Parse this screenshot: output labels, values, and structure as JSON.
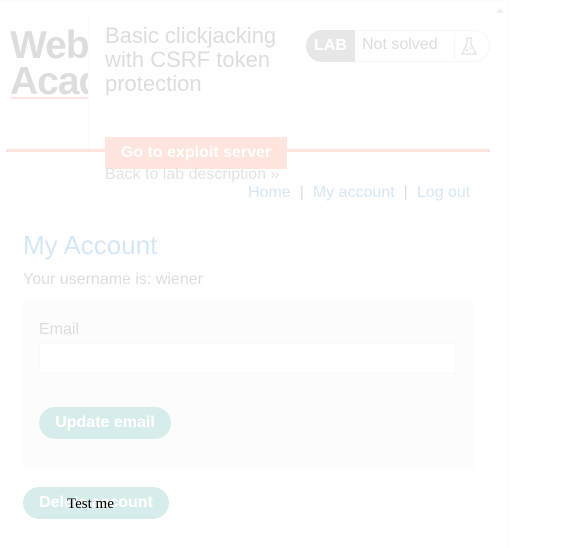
{
  "logo": {
    "text": "Web Security Academy"
  },
  "lab": {
    "title": "Basic clickjacking with CSRF token protection",
    "status_badge": "LAB",
    "status_text": "Not solved",
    "exploit_button": "Go to exploit server",
    "back_link": "Back to lab description",
    "back_link_icon": "double-chevron-right-icon",
    "flask_icon": "flask-icon"
  },
  "nav": {
    "home": "Home",
    "separator": "|",
    "my_account": "My account",
    "log_out": "Log out"
  },
  "account": {
    "heading": "My Account",
    "username_line": "Your username is: wiener",
    "email_label": "Email",
    "email_value": "",
    "update_button": "Update email",
    "delete_button": "Delete account"
  },
  "decoy": {
    "text": "Test me"
  },
  "colors": {
    "accent_orange": "#ff6633",
    "link_blue": "#0071bc",
    "button_teal": "#0f9688",
    "frame_opacity_note": "faded iframe overlay"
  }
}
